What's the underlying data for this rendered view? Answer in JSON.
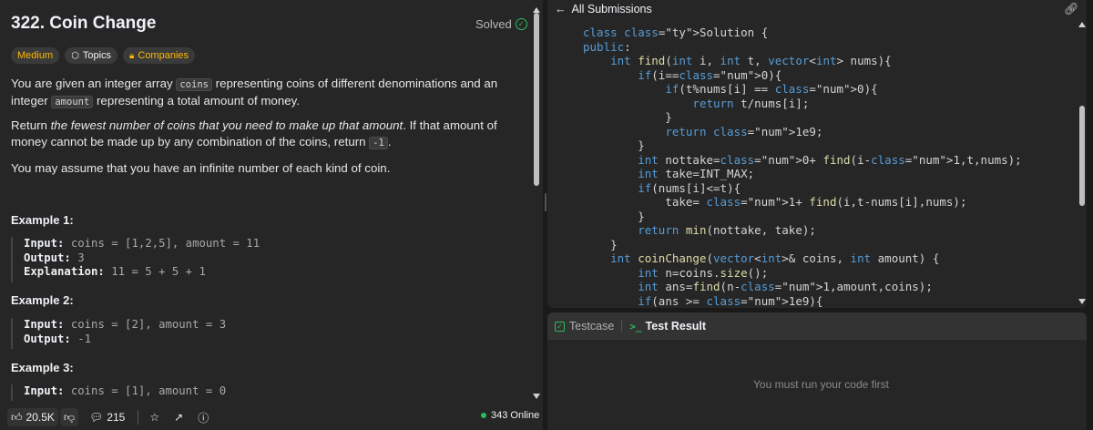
{
  "problem": {
    "title": "322. Coin Change",
    "status": "Solved",
    "difficulty": "Medium",
    "topics_label": "Topics",
    "companies_label": "Companies",
    "desc1_a": "You are given an integer array ",
    "desc1_code1": "coins",
    "desc1_b": " representing coins of different denominations and an integer ",
    "desc1_code2": "amount",
    "desc1_c": " representing a total amount of money.",
    "desc2_a": "Return ",
    "desc2_ital": "the fewest number of coins that you need to make up that amount",
    "desc2_b": ". If that amount of money cannot be made up by any combination of the coins, return ",
    "desc2_code": "-1",
    "desc2_c": ".",
    "desc3": "You may assume that you have an infinite number of each kind of coin.",
    "examples": [
      {
        "heading": "Example 1:",
        "input_label": "Input:",
        "input_value": " coins = [1,2,5], amount = 11",
        "output_label": "Output:",
        "output_value": " 3",
        "explanation_label": "Explanation:",
        "explanation_value": " 11 = 5 + 5 + 1"
      },
      {
        "heading": "Example 2:",
        "input_label": "Input:",
        "input_value": " coins = [2], amount = 3",
        "output_label": "Output:",
        "output_value": " -1"
      },
      {
        "heading": "Example 3:",
        "input_label": "Input:",
        "input_value": " coins = [1], amount = 0"
      }
    ]
  },
  "footer": {
    "likes": "20.5K",
    "comments": "215",
    "online": "343 Online"
  },
  "editor": {
    "back_label": "All Submissions",
    "code_lines": [
      "class Solution {",
      "public:",
      "    int find(int i, int t, vector<int> nums){",
      "        if(i==0){",
      "            if(t%nums[i] == 0){",
      "                return t/nums[i];",
      "            }",
      "            return 1e9;",
      "        }",
      "        int nottake=0+ find(i-1,t,nums);",
      "        int take=INT_MAX;",
      "        if(nums[i]<=t){",
      "            take= 1+ find(i,t-nums[i],nums);",
      "        }",
      "        return min(nottake, take);",
      "    }",
      "    int coinChange(vector<int>& coins, int amount) {",
      "        int n=coins.size();",
      "        int ans=find(n-1,amount,coins);",
      "        if(ans >= 1e9){"
    ]
  },
  "result_panel": {
    "tab_testcase": "Testcase",
    "tab_result": "Test Result",
    "message": "You must run your code first"
  },
  "colors": {
    "accent_green": "#2cbb5d",
    "medium": "#ffb800",
    "panel_bg": "#262626"
  }
}
